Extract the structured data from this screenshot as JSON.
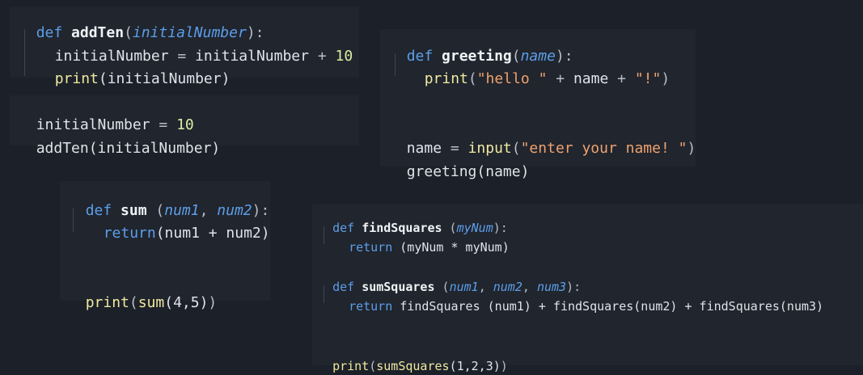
{
  "snippets": {
    "add_ten": {
      "line1": {
        "def": "def ",
        "name": "addTen",
        "open": "(",
        "param": "initialNumber",
        "close": "):"
      },
      "line2": {
        "var": "initialNumber",
        "assign": " = ",
        "var2": "initialNumber",
        "plus": " + ",
        "num": "10"
      },
      "line3": {
        "call": "print",
        "args": "(initialNumber)"
      },
      "line4": {
        "var": "initialNumber",
        "assign": " = ",
        "num": "10"
      },
      "line5": {
        "call": "addTen",
        "args": "(initialNumber)"
      }
    },
    "greeting": {
      "line1": {
        "def": "def ",
        "name": "greeting",
        "open": "(",
        "param": "name",
        "close": "):"
      },
      "line2": {
        "call": "print",
        "open": "(",
        "str1": "\"hello \"",
        "plus1": " + ",
        "var": "name",
        "plus2": " + ",
        "str2": "\"!\"",
        "close": ")"
      },
      "line3": {
        "var": "name",
        "assign": " = ",
        "call": "input",
        "open": "(",
        "str": "\"enter your name! \"",
        "close": ")"
      },
      "line4": {
        "call": "greeting",
        "args": "(name)"
      }
    },
    "sum": {
      "line1": {
        "def": "def ",
        "name": "sum",
        "open": " (",
        "param1": "num1",
        "comma": ", ",
        "param2": "num2",
        "close": "):"
      },
      "line2": {
        "kw": "return",
        "args": "(num1 + num2)"
      },
      "line3": {
        "call": "print",
        "open": "(",
        "call2": "sum",
        "args": "(4,5)",
        "close": ")"
      }
    },
    "squares": {
      "line1": {
        "def": "def ",
        "name": "findSquares",
        "open": " (",
        "param": "myNum",
        "close": "):"
      },
      "line2": {
        "kw": "return",
        "args": " (myNum * myNum)"
      },
      "line3": {
        "def": "def ",
        "name": "sumSquares",
        "open": " (",
        "param1": "num1",
        "comma1": ", ",
        "param2": "num2",
        "comma2": ", ",
        "param3": "num3",
        "close": "):"
      },
      "line4": {
        "kw": "return",
        "rest": " findSquares (num1) + findSquares(num2) + findSquares(num3)"
      },
      "line5": {
        "call": "print",
        "open": "(",
        "call2": "sumSquares",
        "args": "(1,2,3)",
        "close": ")"
      }
    }
  }
}
